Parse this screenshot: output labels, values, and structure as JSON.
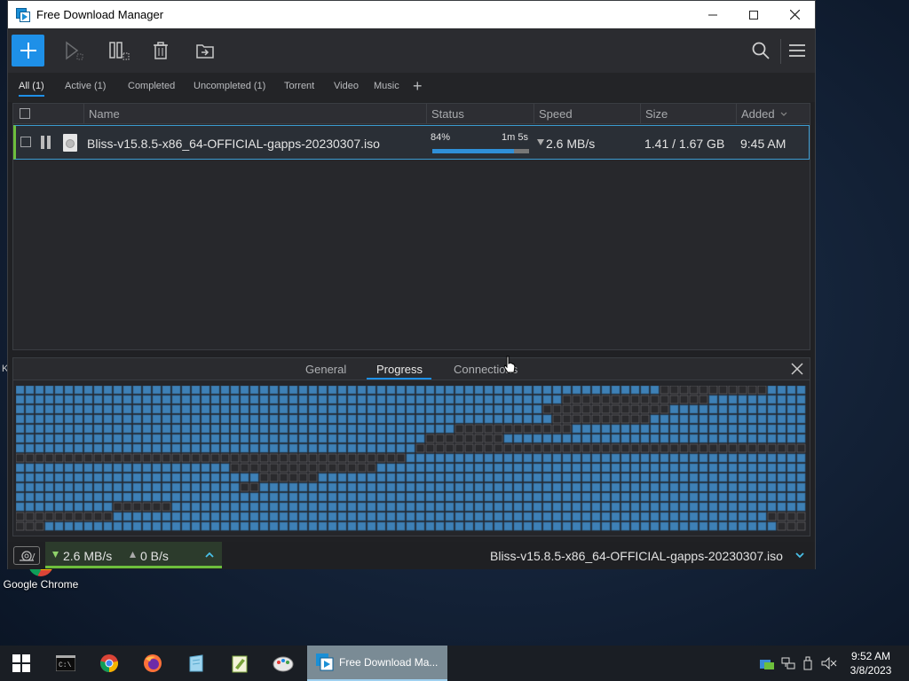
{
  "window": {
    "title": "Free Download Manager"
  },
  "filters": [
    {
      "label": "All (1)",
      "active": true
    },
    {
      "label": "Active (1)",
      "active": false
    },
    {
      "label": "Completed",
      "active": false
    },
    {
      "label": "Uncompleted (1)",
      "active": false
    },
    {
      "label": "Torrent",
      "active": false
    },
    {
      "label": "Video",
      "active": false
    },
    {
      "label": "Music",
      "active": false
    }
  ],
  "columns": {
    "name": "Name",
    "status": "Status",
    "speed": "Speed",
    "size": "Size",
    "added": "Added"
  },
  "download": {
    "name": "Bliss-v15.8.5-x86_64-OFFICIAL-gapps-20230307.iso",
    "percent": "84%",
    "progress": 0.84,
    "eta": "1m 5s",
    "speed": "2.6 MB/s",
    "size": "1.41 / 1.67 GB",
    "added": "9:45 AM"
  },
  "detail_tabs": {
    "general": "General",
    "progress": "Progress",
    "connections": "Connections"
  },
  "statusbar": {
    "down_speed": "2.6 MB/s",
    "up_speed": "0 B/s",
    "current_file": "Bliss-v15.8.5-x86_64-OFFICIAL-gapps-20230307.iso"
  },
  "desktop": {
    "chrome_label": "Google Chrome",
    "edge_letter": "K"
  },
  "taskbar": {
    "active_app": "Free Download Ma...",
    "time": "9:52 AM",
    "date": "3/8/2023"
  },
  "colors": {
    "accent": "#1e90e8",
    "active_green": "#6dbf3c",
    "piece_done": "#3e80b6",
    "piece_pending": "#2a2a2d"
  },
  "icons": {
    "add": "plus-icon",
    "start": "play-icon",
    "pause": "pause-icon",
    "delete": "trash-icon",
    "move": "folder-move-icon",
    "search": "search-icon",
    "menu": "hamburger-icon"
  }
}
